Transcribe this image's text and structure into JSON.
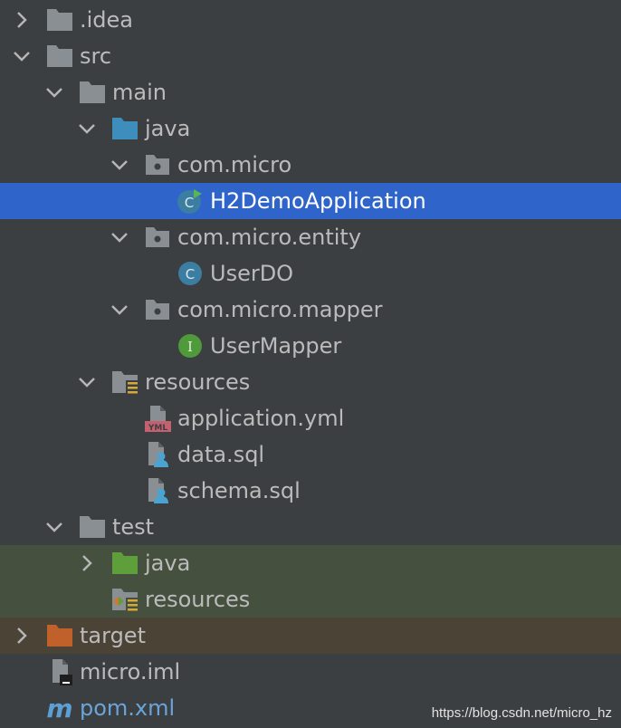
{
  "tree": {
    "items": [
      {
        "label": ".idea"
      },
      {
        "label": "src"
      },
      {
        "label": "main"
      },
      {
        "label": "java"
      },
      {
        "label": "com.micro"
      },
      {
        "label": "H2DemoApplication"
      },
      {
        "label": "com.micro.entity"
      },
      {
        "label": "UserDO"
      },
      {
        "label": "com.micro.mapper"
      },
      {
        "label": "UserMapper"
      },
      {
        "label": "resources"
      },
      {
        "label": "application.yml"
      },
      {
        "label": "data.sql"
      },
      {
        "label": "schema.sql"
      },
      {
        "label": "test"
      },
      {
        "label": "java"
      },
      {
        "label": "resources"
      },
      {
        "label": "target"
      },
      {
        "label": "micro.iml"
      },
      {
        "label": "pom.xml"
      }
    ]
  },
  "badges": {
    "class_letter": "C",
    "interface_letter": "I",
    "yml_tag": "YML",
    "maven_letter": "m"
  },
  "watermark": "https://blog.csdn.net/micro_hz",
  "colors": {
    "background": "#3c3f41",
    "selection": "#2f65ca",
    "folder": "#8a8f94",
    "source_folder": "#3d8dbd",
    "test_folder": "#5e9e3b",
    "excluded_folder": "#c0602a",
    "class_icon": "#3b7ea1",
    "interface_icon": "#4f9a3a"
  }
}
